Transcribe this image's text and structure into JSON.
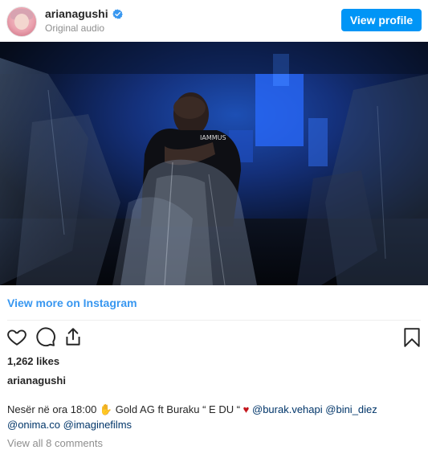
{
  "header": {
    "username": "arianagushi",
    "subtitle": "Original audio",
    "view_profile_label": "View profile",
    "verified_icon": "verified-badge-icon"
  },
  "media": {
    "shirt_text": "IAMMUS"
  },
  "view_more_label": "View more on Instagram",
  "actions": {
    "like_icon": "heart-icon",
    "comment_icon": "comment-icon",
    "share_icon": "share-icon",
    "save_icon": "bookmark-icon"
  },
  "likes_text": "1,262 likes",
  "caption": {
    "username": "arianagushi",
    "line1_pre": "Nesër në ora 18:00 ",
    "emoji_hand": "✋",
    "line1_mid": " Gold AG ft Buraku “ E DU “ ",
    "emoji_heart": "♥",
    "mention1": "@burak.vehapi",
    "mention2": "@bini_diez",
    "mention3": "@onima.co",
    "mention4": "@imaginefilms"
  },
  "comments_link": "View all 8 comments",
  "colors": {
    "accent": "#0095f6",
    "link": "#3897f0",
    "mention": "#003569",
    "muted": "#8e8e8e"
  }
}
